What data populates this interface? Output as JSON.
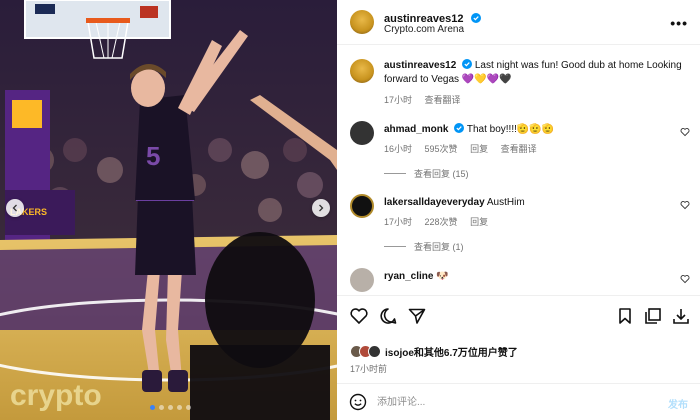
{
  "post": {
    "username": "austinreaves12",
    "location": "Crypto.com Arena",
    "caption_user": "austinreaves12",
    "caption": "Last night was fun! Good dub at home Looking forward to Vegas 💜💛💜🖤",
    "caption_time": "17小时",
    "see_translation": "查看翻译"
  },
  "comments": [
    {
      "username": "ahmad_monk",
      "text": "That boy!!!!🫡🫡🫡",
      "time": "16小时",
      "likes": "595次赞",
      "reply": "回复",
      "translate": "查看翻译",
      "view_replies": "查看回复 (15)"
    },
    {
      "username": "lakersalldayeveryday",
      "text": "AustHim",
      "time": "17小时",
      "likes": "228次赞",
      "reply": "回复",
      "view_replies": "查看回复 (1)"
    },
    {
      "username": "ryan_cline",
      "text": "🐶"
    }
  ],
  "likes": {
    "text": "isojoe和其他",
    "count": "6.7万",
    "suffix": "位用户赞了"
  },
  "post_time": "17小时前",
  "composer": {
    "placeholder": "添加评论...",
    "post_label": "发布"
  },
  "carousel": {
    "total": 5,
    "active": 1
  },
  "image_text": {
    "lakers_logo": "LAKERS",
    "jersey_number": "5",
    "court_text": "crypto"
  },
  "colors": {
    "verified": "#0095f6",
    "lakers_purple": "#552583",
    "lakers_gold": "#fdb927",
    "post_button": "#b2dffc"
  },
  "icons": [
    "heart-icon",
    "comment-icon",
    "share-icon",
    "bookmark-icon",
    "add-collection-icon",
    "download-icon",
    "emoji-icon",
    "more-icon",
    "verified-icon",
    "chevron-left-icon",
    "chevron-right-icon"
  ]
}
